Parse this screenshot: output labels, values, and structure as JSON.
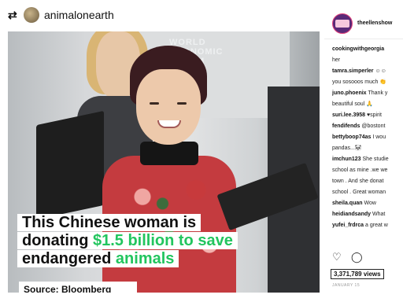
{
  "left_header": {
    "username": "animalonearth",
    "repost_icon": "repost-icon"
  },
  "post": {
    "background_sign_text": "WORLD\nECONOMIC\nFORUM",
    "caption_lines": [
      {
        "parts": [
          {
            "text": "This Chinese woman is",
            "color": "#111111"
          }
        ]
      },
      {
        "parts": [
          {
            "text": "donating ",
            "color": "#111111"
          },
          {
            "text": "$1.5 billion to save",
            "color": "#22c55e"
          }
        ]
      },
      {
        "parts": [
          {
            "text": "endangered ",
            "color": "#111111"
          },
          {
            "text": "animals",
            "color": "#22c55e"
          }
        ]
      }
    ],
    "source": "Source: Bloomberg"
  },
  "sidebar": {
    "account": "theellenshow",
    "comments": [
      {
        "user": "cookingwithgeorgia",
        "text": ""
      },
      {
        "user": "",
        "text": "her"
      },
      {
        "user": "tamra.simperler",
        "text": "☺☺"
      },
      {
        "user": "",
        "text": "you sosooos much 👏"
      },
      {
        "user": "juno.phoenix",
        "text": "Thank y"
      },
      {
        "user": "",
        "text": "beautiful soul 🙏"
      },
      {
        "user": "suri.lee.3958",
        "text": "♥spirit"
      },
      {
        "user": "fendifends",
        "text": "@bostont"
      },
      {
        "user": "bettyboop74as",
        "text": "I wou"
      },
      {
        "user": "",
        "text": "pandas...🐼"
      },
      {
        "user": "imchun123",
        "text": "She studie"
      },
      {
        "user": "",
        "text": "school as mine .we we"
      },
      {
        "user": "",
        "text": "town . And she donat"
      },
      {
        "user": "",
        "text": "school . Great woman"
      },
      {
        "user": "sheila.quan",
        "text": "Wow"
      },
      {
        "user": "heidiandsandy",
        "text": "What"
      },
      {
        "user": "yufei_frdrca",
        "text": "a great w"
      }
    ],
    "views": "3,371,789 views",
    "date": "JANUARY 15"
  },
  "colors": {
    "accent_green": "#22c55e",
    "caption_bg": "#ffffff"
  }
}
